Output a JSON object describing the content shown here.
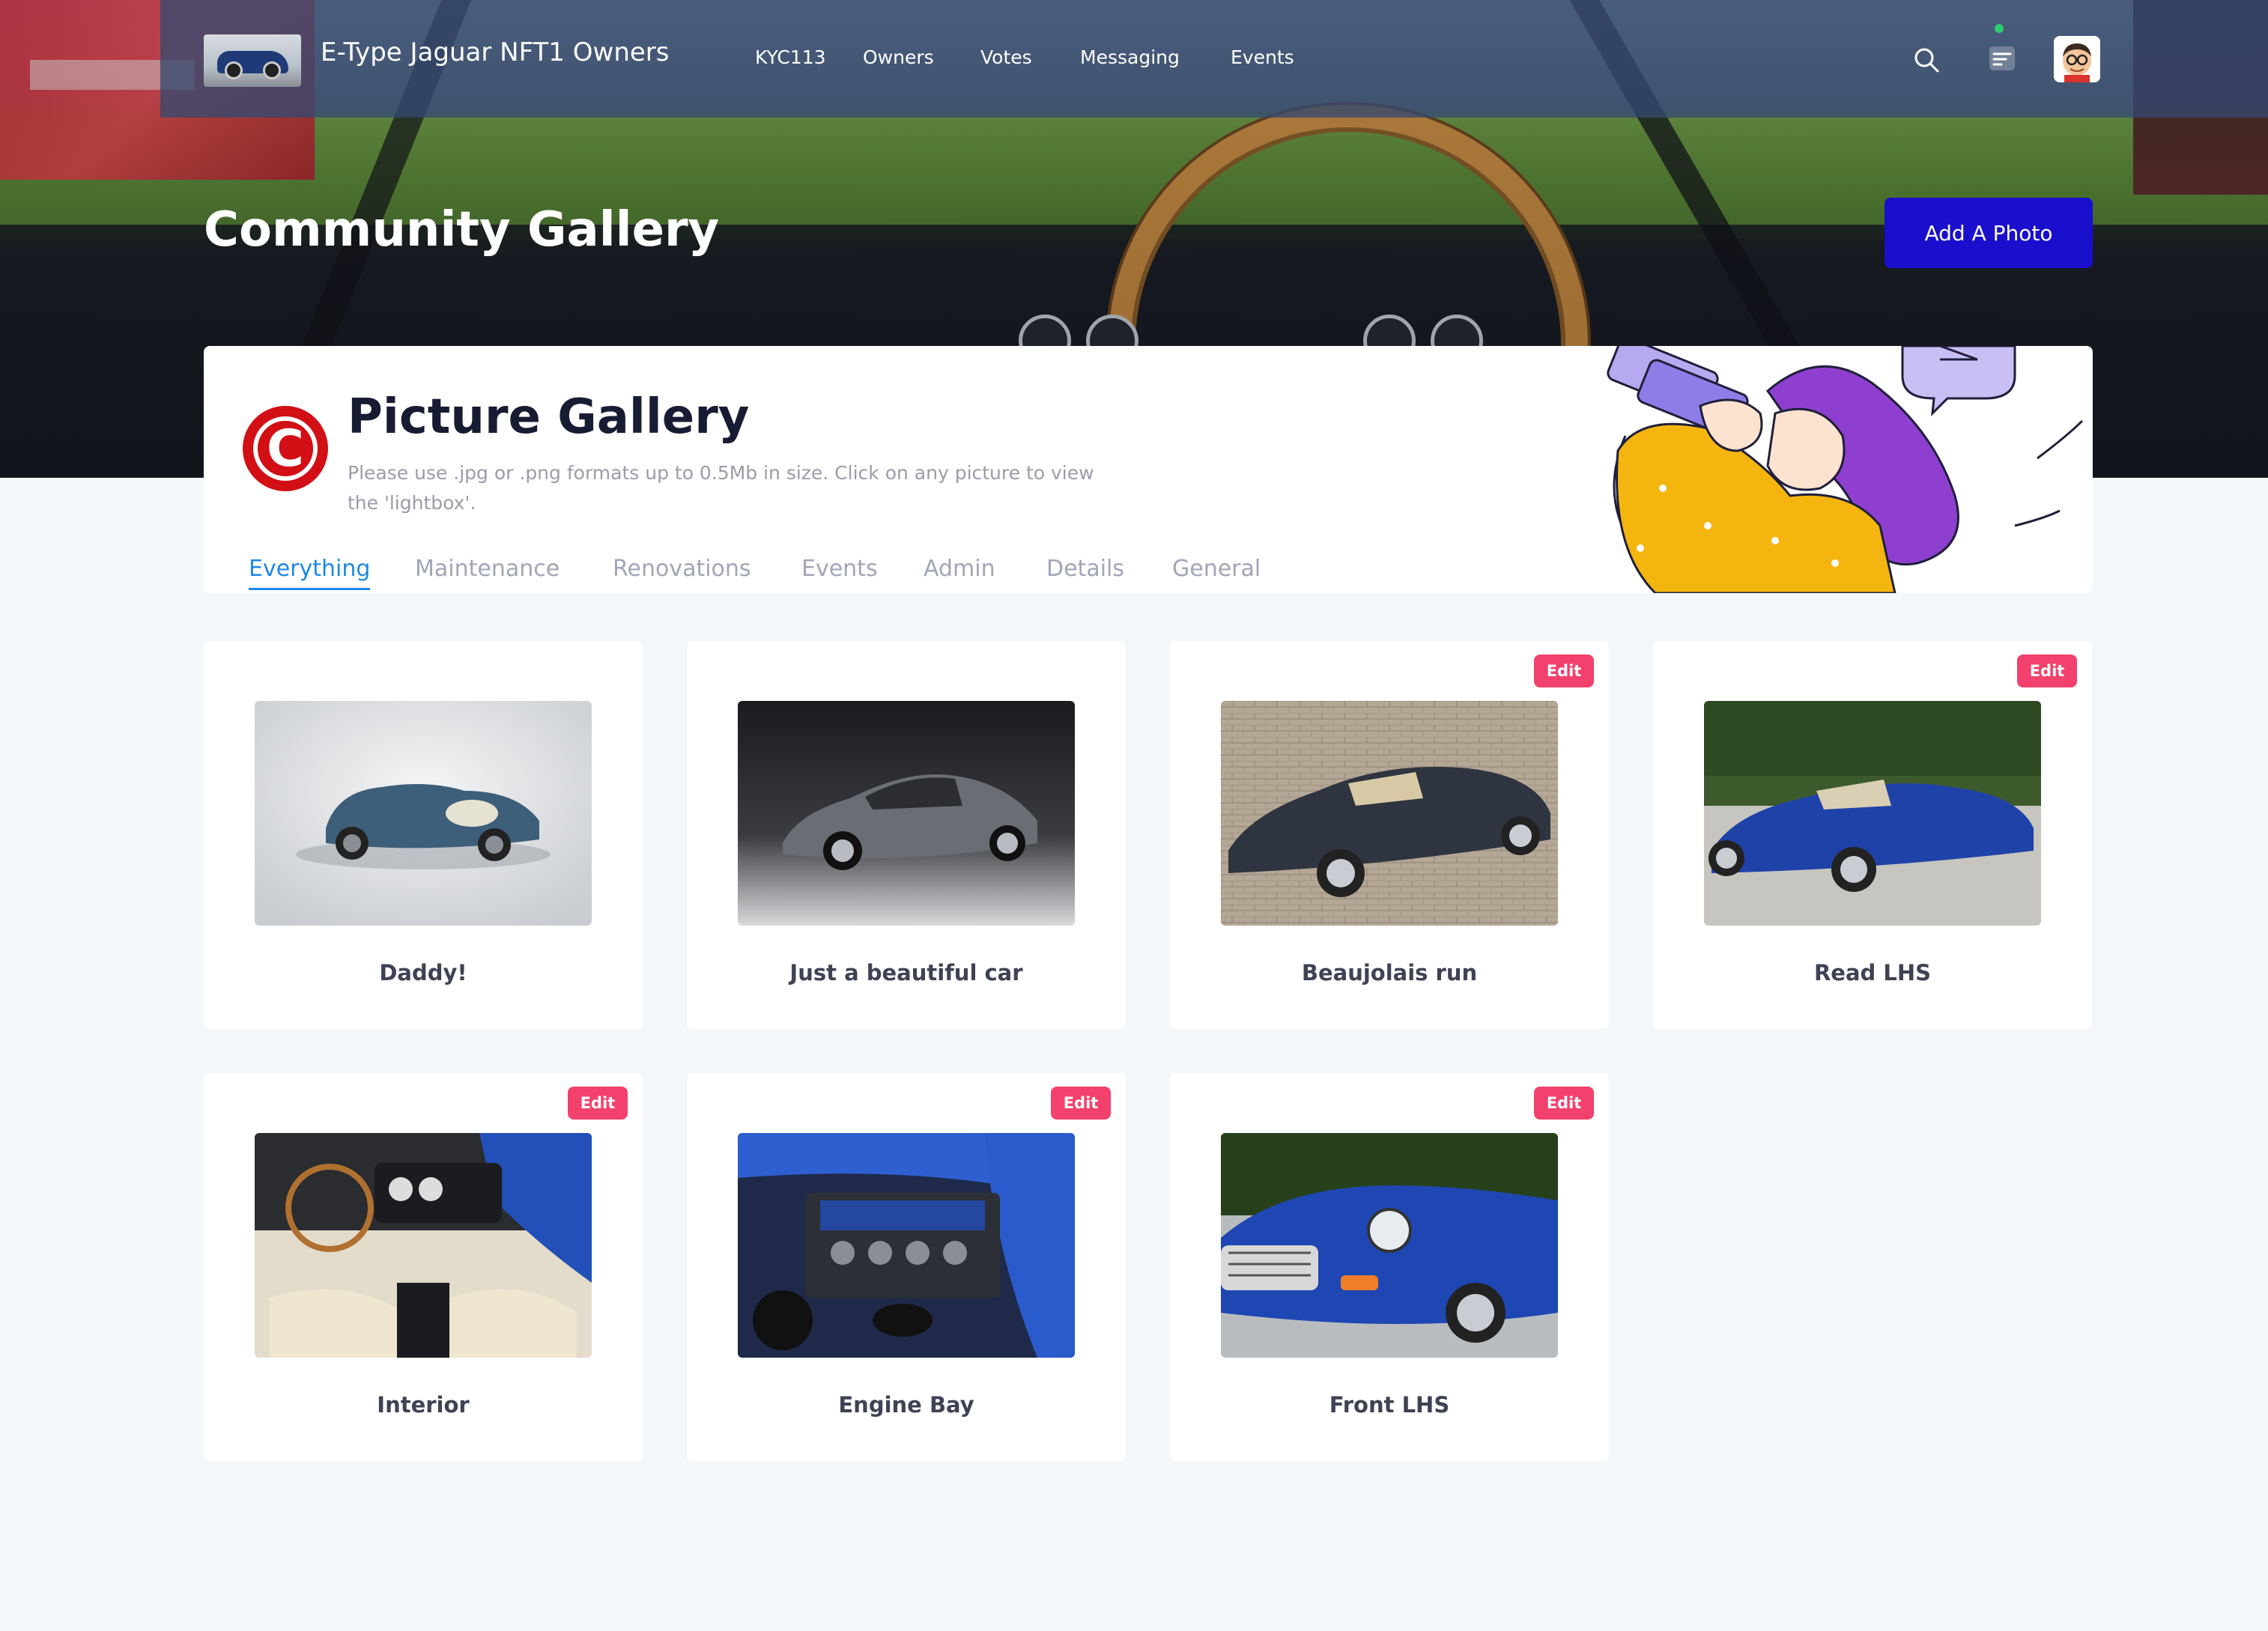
{
  "app": {
    "brand_name": "E-Type Jaguar NFT1 Owners",
    "nav": [
      "KYC113",
      "Owners",
      "Votes",
      "Messaging",
      "Events"
    ],
    "icons": {
      "search": "search-icon",
      "menu": "menu-lines-icon",
      "avatar": "user-avatar"
    },
    "notification_color": "#2ecc71"
  },
  "hero": {
    "title": "Community Gallery",
    "add_photo_label": "Add A Photo",
    "add_photo_color": "#1a0fcc"
  },
  "gallery": {
    "logo_letter": "C",
    "logo_color": "#d10f14",
    "title": "Picture Gallery",
    "help_text": "Please use .jpg or .png formats up to 0.5Mb in size.   Click on any picture to view the 'lightbox'.",
    "tabs": [
      "Everything",
      "Maintenance",
      "Renovations",
      "Events",
      "Admin",
      "Details",
      "General"
    ],
    "active_tab": "Everything",
    "accent_color": "#1e88e5"
  },
  "photos": [
    {
      "caption": "Daddy!",
      "editable": false,
      "edit_label": ""
    },
    {
      "caption": "Just a beautiful car",
      "editable": false,
      "edit_label": ""
    },
    {
      "caption": "Beaujolais run",
      "editable": true,
      "edit_label": "Edit"
    },
    {
      "caption": "Read LHS",
      "editable": true,
      "edit_label": "Edit"
    },
    {
      "caption": "Interior",
      "editable": true,
      "edit_label": "Edit"
    },
    {
      "caption": "Engine Bay",
      "editable": true,
      "edit_label": "Edit"
    },
    {
      "caption": "Front LHS",
      "editable": true,
      "edit_label": "Edit"
    }
  ],
  "edit_badge_color": "#f1416c"
}
